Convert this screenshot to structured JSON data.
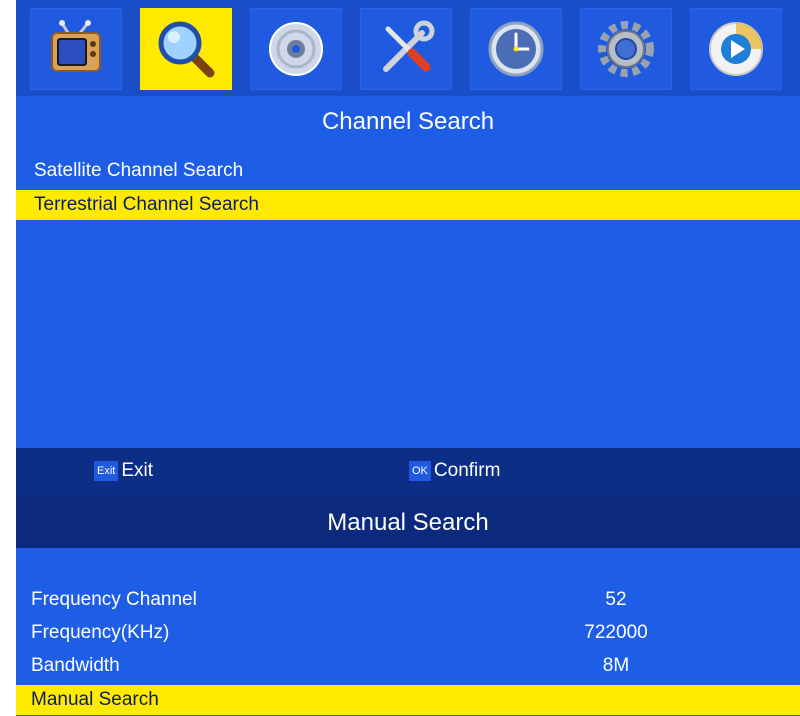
{
  "menu": {
    "tabs": [
      {
        "icon": "tv-icon"
      },
      {
        "icon": "magnifier-icon",
        "active": true
      },
      {
        "icon": "disc-icon"
      },
      {
        "icon": "tools-icon"
      },
      {
        "icon": "clock-icon"
      },
      {
        "icon": "gear-icon"
      },
      {
        "icon": "play-icon"
      }
    ]
  },
  "channel_search": {
    "title": "Channel Search",
    "items": [
      "Satellite Channel Search",
      "Terrestrial Channel Search"
    ],
    "selected_index": 1
  },
  "footer": {
    "exit_key": "Exit",
    "exit_label": "Exit",
    "ok_key": "OK",
    "ok_label": "Confirm"
  },
  "manual_search": {
    "title": "Manual Search",
    "rows": [
      {
        "label": "Frequency Channel",
        "value": "52"
      },
      {
        "label": "Frequency(KHz)",
        "value": "722000"
      },
      {
        "label": "Bandwidth",
        "value": "8M"
      }
    ],
    "action": "Manual Search"
  },
  "colors": {
    "panel_blue": "#1e5ee6",
    "highlight_yellow": "#ffea00",
    "dark_bar": "#0c2e86"
  }
}
